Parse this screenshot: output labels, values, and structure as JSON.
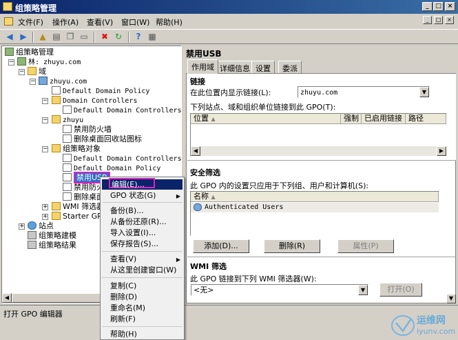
{
  "window": {
    "title": "组策略管理"
  },
  "menubar": {
    "items": [
      "文件(F)",
      "操作(A)",
      "查看(V)",
      "窗口(W)",
      "帮助(H)"
    ]
  },
  "tree": {
    "root": "组策略管理",
    "forest": "林: zhuyu.com",
    "domains": "域",
    "domain": "zhuyu.com",
    "default_domain_policy": "Default Domain Policy",
    "domain_controllers": "Domain Controllers",
    "default_dc_policy": "Default Domain Controllers Po",
    "ou": "zhuyu",
    "firewall": "禁用防火墙",
    "recycle": "删除桌面回收站图标",
    "gpo_objects": "组策略对象",
    "obj_dc_policy": "Default Domain Controllers Po",
    "obj_domain_policy": "Default Domain Policy",
    "obj_usb": "禁用USB",
    "obj_firewall": "禁用防火墙",
    "obj_recycle": "删除桌面回收站图标",
    "wmi_filters": "WMI 筛选器",
    "starter_gpo": "Starter GPO",
    "sites": "站点",
    "modeling": "组策略建模",
    "results": "组策略结果"
  },
  "right": {
    "header": "禁用USB",
    "tabs": [
      "作用域",
      "详细信息",
      "设置",
      "委派"
    ],
    "links": {
      "title": "链接",
      "show_label": "在此位置内显示链接(L):",
      "show_value": "zhuyu.com",
      "linked_label": "下列站点、域和组织单位链接到此 GPO(T):",
      "columns": [
        "位置",
        "强制",
        "已启用链接",
        "路径"
      ]
    },
    "security": {
      "title": "安全筛选",
      "desc": "此 GPO 内的设置只应用于下列组、用户和计算机(S):",
      "column": "名称",
      "rows": [
        "Authenticated Users"
      ],
      "add": "添加(D)...",
      "remove": "删除(R)",
      "properties": "属性(P)"
    },
    "wmi": {
      "title": "WMI 筛选",
      "desc": "此 GPO 链接到下列 WMI 筛选器(W):",
      "value": "<无>",
      "open": "打开(O)"
    }
  },
  "context_menu": {
    "edit": "编辑(E)...",
    "status": "GPO 状态(G)",
    "backup": "备份(B)...",
    "restore": "从备份还原(R)...",
    "import": "导入设置(I)...",
    "report": "保存报告(S)...",
    "view": "查看(V)",
    "new_window": "从这里创建窗口(W)",
    "copy": "复制(C)",
    "delete": "删除(D)",
    "rename": "重命名(M)",
    "refresh": "刷新(F)",
    "help": "帮助(H)"
  },
  "statusbar": {
    "text": "打开 GPO 编辑器"
  },
  "watermark": {
    "text_cn": "运维网",
    "text_en": "iyunv.com"
  }
}
